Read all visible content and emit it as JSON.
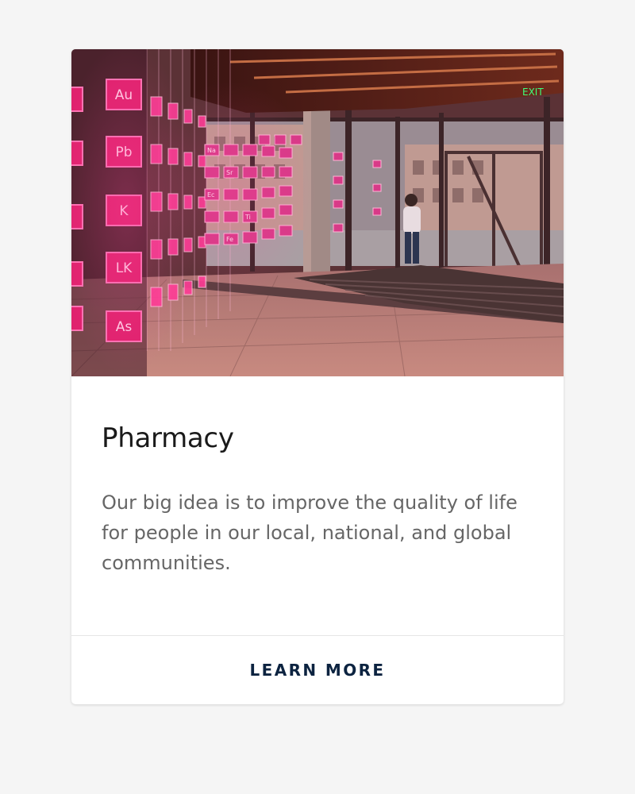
{
  "card": {
    "image_alt": "Building lobby with pink neon element-symbol installation",
    "title": "Pharmacy",
    "description": "Our big idea is to improve the quality of life for people in our local, national, and global communities.",
    "action_label": "LEARN MORE"
  },
  "image_content": {
    "neon_symbols": [
      "Au",
      "Pb",
      "K",
      "LK",
      "As",
      "Na",
      "Sr",
      "Ec",
      "Ti",
      "Fe"
    ],
    "exit_sign": "EXIT"
  },
  "colors": {
    "page_background": "#f5f5f5",
    "card_background": "#ffffff",
    "title": "#1a1a1a",
    "body_text": "#666666",
    "action_text": "#0c2340",
    "neon": "#ff3c96"
  }
}
